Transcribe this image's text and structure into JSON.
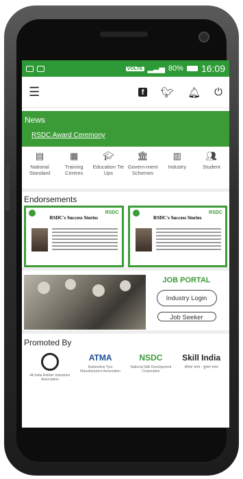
{
  "status_bar": {
    "network": "VOLTE",
    "battery": "80%",
    "time": "16:09"
  },
  "appbar": {
    "menu_icon": "hamburger-icon",
    "icons": [
      "facebook-icon",
      "twitter-icon",
      "bell-icon",
      "power-icon"
    ]
  },
  "news": {
    "title": "News",
    "headline": "RSDC Award Ceremony"
  },
  "categories": [
    {
      "label": "National Standard",
      "icon": "document-icon"
    },
    {
      "label": "Training Centres",
      "icon": "list-icon"
    },
    {
      "label": "Education Tie Ups",
      "icon": "graduation-cap-icon"
    },
    {
      "label": "Govern-ment Schemes",
      "icon": "bank-icon"
    },
    {
      "label": "Industry",
      "icon": "building-icon"
    },
    {
      "label": "Student",
      "icon": "people-icon"
    }
  ],
  "endorsements": {
    "title": "Endorsements",
    "cards": [
      {
        "title": "RSDC's Success Stories",
        "logo": "RSDC"
      },
      {
        "title": "RSDC's Success Stories",
        "logo": "RSDC"
      }
    ]
  },
  "job_portal": {
    "title": "JOB PORTAL",
    "industry_login": "Industry Login",
    "job_seeker": "Job Seeker"
  },
  "promoted": {
    "title": "Promoted By",
    "logos": [
      {
        "name": "AIRIA",
        "caption": "All India Rubber Industries Association"
      },
      {
        "name": "ATMA",
        "caption": "Automotive Tyre Manufacturers Association"
      },
      {
        "name": "NSDC",
        "caption": "National Skill Development Corporation"
      },
      {
        "name": "Skill India",
        "caption": "कौशल भारत - कुशल भारत"
      }
    ]
  },
  "colors": {
    "accent": "#3a9b37"
  }
}
